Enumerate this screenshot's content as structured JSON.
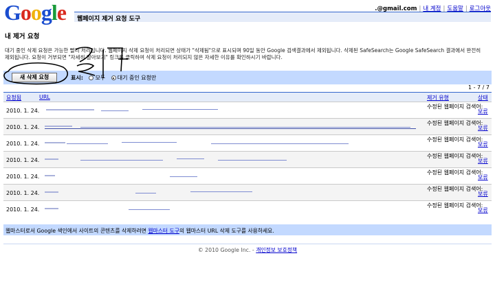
{
  "header": {
    "logo_text": "Google",
    "tool_title": "웹페이지 제거 요청 도구",
    "email": ".@gmail.com",
    "links": [
      "내 계정",
      "도움말",
      "로그아웃"
    ]
  },
  "page_title": "내 제거 요청",
  "intro_text": "대기 중인 삭제 요청은 가능한 빨리 처리됩니다. 웹페이지 삭제 요청이 처리되면 상태가 \"삭제됨\"으로 표시되며 90일 동안 Google 검색결과에서 제외됩니다. 삭제된 SafeSearch는 Google SafeSearch 결과에서 완전히 제외됩니다. 요청이 거부되면 \"자세히 알아보기\" 링크를 클릭하여 삭제 요청이 처리되지 않은 자세한 이유를 확인하시기 바랍니다.",
  "filter": {
    "new_request_label": "새 삭제 요청",
    "show_label": "표시:",
    "options": [
      "모두",
      "대기 중인 요청만"
    ],
    "selected": "대기 중인 요청만"
  },
  "count_text": "1 - 7 / 7",
  "table": {
    "headers": {
      "requested": "요청됨",
      "url": "URL",
      "reason": "제거 유형",
      "status": "상태"
    },
    "rows": [
      {
        "date": "2010. 1. 24.",
        "reason": "수정된 웹페이지 검색어:",
        "status": "보류"
      },
      {
        "date": "2010. 1. 24.",
        "reason": "수정된 웹페이지 검색어:",
        "status": "보류"
      },
      {
        "date": "2010. 1. 24.",
        "reason": "수정된 웹페이지 검색어:",
        "status": "보류"
      },
      {
        "date": "2010. 1. 24.",
        "reason": "수정된 웹페이지 검색어:",
        "status": "보류"
      },
      {
        "date": "2010. 1. 24.",
        "reason": "수정된 웹페이지 검색어:",
        "status": "보류"
      },
      {
        "date": "2010. 1. 24.",
        "reason": "수정된 웹페이지 검색어:",
        "status": "보류"
      },
      {
        "date": "2010. 1. 24.",
        "reason": "수정된 웹페이지 검색어:",
        "status": "보류"
      }
    ]
  },
  "footer": {
    "note_before": "웹마스터로서 Google 색인에서 사이트의 콘텐츠를 삭제하려면 ",
    "note_link": "웹마스터 도구",
    "note_after": "의 웹마스터 URL 삭제 도구를 사용하세요.",
    "copyright": "© 2010 Google Inc. - ",
    "privacy_link": "개인정보 보호정책"
  },
  "colors": {
    "bar_blue": "#c3d9ff",
    "light_blue": "#e5ecf9",
    "link": "#0000cc"
  }
}
